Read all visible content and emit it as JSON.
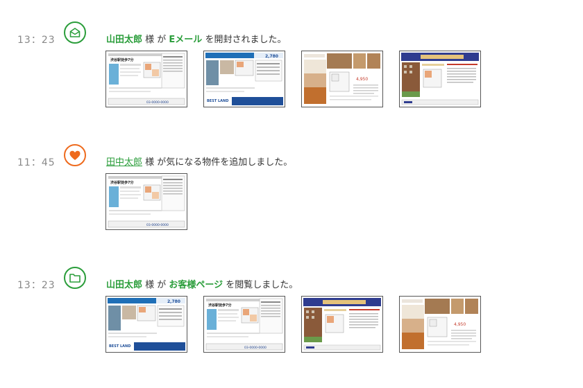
{
  "top_partial_text": "----- -- --",
  "events": [
    {
      "time": "13：23",
      "icon": "envelope-open-icon",
      "actor": "山田太郎",
      "honorific": " 様 が ",
      "target": "Eメール",
      "action": " を開封されました。",
      "thumbnails": [
        "flyer-gray-7min",
        "flyer-blue-2780",
        "flyer-wood-interior",
        "flyer-brown-building"
      ]
    },
    {
      "time": "11：45",
      "icon": "heart-icon",
      "actor": "田中太郎",
      "honorific": " 様 が気になる物件を追加しました。",
      "target": "",
      "action": "",
      "thumbnails": [
        "flyer-gray-7min"
      ]
    },
    {
      "time": "13：23",
      "icon": "folder-icon",
      "actor": "山田太郎",
      "honorific": " 様 が ",
      "target": "お客様ページ",
      "action": " を閲覧しました。",
      "thumbnails": [
        "flyer-blue-2780",
        "flyer-gray-7min",
        "flyer-brown-building",
        "flyer-wood-interior"
      ]
    }
  ],
  "flyer_text": {
    "gray_title": "渋谷駅徒歩7分",
    "gray_phone": "03-0000-0000",
    "blue_price": "2,780",
    "blue_brand": "BEST LAND",
    "wood_price": "4,950"
  },
  "colors": {
    "green": "#2a9d3a",
    "orange": "#ee6a1d"
  }
}
